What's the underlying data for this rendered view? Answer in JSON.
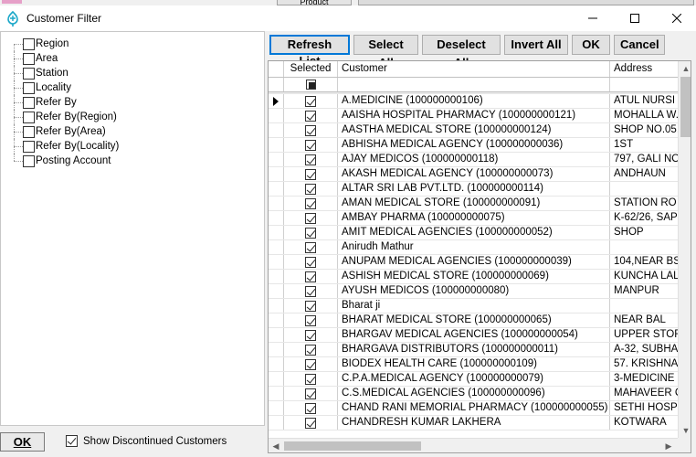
{
  "background_tab": {
    "label": "Product"
  },
  "window": {
    "title": "Customer Filter",
    "min_glyph": "—",
    "max_glyph": "☐",
    "close_glyph": "✕"
  },
  "tree": {
    "items": [
      {
        "label": "Region",
        "checked": false
      },
      {
        "label": "Area",
        "checked": false
      },
      {
        "label": "Station",
        "checked": false
      },
      {
        "label": "Locality",
        "checked": false
      },
      {
        "label": "Refer By",
        "checked": false
      },
      {
        "label": "Refer By(Region)",
        "checked": false
      },
      {
        "label": "Refer By(Area)",
        "checked": false
      },
      {
        "label": "Refer By(Locality)",
        "checked": false
      },
      {
        "label": "Posting Account",
        "checked": false
      }
    ]
  },
  "footer": {
    "ok_label": "OK",
    "show_discontinued_label": "Show Discontinued Customers",
    "show_discontinued_checked": true
  },
  "toolbar": {
    "refresh_label": "Refresh List",
    "select_all_label": "Select All",
    "deselect_all_label": "Deselect All",
    "invert_all_label": "Invert All",
    "ok_label": "OK",
    "cancel_label": "Cancel"
  },
  "grid": {
    "columns": {
      "selected": "Selected",
      "customer": "Customer",
      "address": "Address"
    },
    "rows": [
      {
        "customer": "A.MEDICINE (100000000106)",
        "address": "ATUL NURSI",
        "selected": true,
        "current": true
      },
      {
        "customer": "AAISHA HOSPITAL PHARMACY (100000000121)",
        "address": "MOHALLA W.",
        "selected": true
      },
      {
        "customer": "AASTHA MEDICAL STORE (100000000124)",
        "address": "SHOP NO.05,",
        "selected": true
      },
      {
        "customer": "ABHISHA MEDICAL AGENCY (100000000036)",
        "address": "1ST",
        "selected": true
      },
      {
        "customer": "AJAY MEDICOS (100000000118)",
        "address": "797, GALI NO",
        "selected": true
      },
      {
        "customer": "AKASH MEDICAL AGENCY (100000000073)",
        "address": "ANDHAUN",
        "selected": true
      },
      {
        "customer": "ALTAR SRI LAB PVT.LTD. (100000000114)",
        "address": "",
        "selected": true
      },
      {
        "customer": "AMAN MEDICAL STORE (100000000091)",
        "address": "STATION RO",
        "selected": true
      },
      {
        "customer": "AMBAY PHARMA (100000000075)",
        "address": "K-62/26, SAP",
        "selected": true
      },
      {
        "customer": "AMIT MEDICAL AGENCIES (100000000052)",
        "address": "SHOP",
        "selected": true
      },
      {
        "customer": "Anirudh Mathur",
        "address": "",
        "selected": true
      },
      {
        "customer": "ANUPAM MEDICAL AGENCIES (100000000039)",
        "address": "104,NEAR BS",
        "selected": true
      },
      {
        "customer": "ASHISH MEDICAL STORE (100000000069)",
        "address": "KUNCHA LAL",
        "selected": true
      },
      {
        "customer": "AYUSH MEDICOS (100000000080)",
        "address": "MANPUR",
        "selected": true
      },
      {
        "customer": "Bharat ji",
        "address": "",
        "selected": true
      },
      {
        "customer": "BHARAT MEDICAL STORE (100000000065)",
        "address": "NEAR BAL",
        "selected": true
      },
      {
        "customer": "BHARGAV MEDICAL AGENCIES (100000000054)",
        "address": "UPPER STOR",
        "selected": true
      },
      {
        "customer": "BHARGAVA DISTRIBUTORS (100000000011)",
        "address": "A-32, SUBHA",
        "selected": true
      },
      {
        "customer": "BIODEX HEALTH CARE (100000000109)",
        "address": "57. KRISHNA",
        "selected": true
      },
      {
        "customer": "C.P.A.MEDICAL AGENCY (100000000079)",
        "address": "3-MEDICINE",
        "selected": true
      },
      {
        "customer": "C.S.MEDICAL AGENCIES (100000000096)",
        "address": "MAHAVEER C",
        "selected": true
      },
      {
        "customer": "CHAND RANI MEMORIAL PHARMACY (100000000055)",
        "address": "SETHI HOSP",
        "selected": true
      },
      {
        "customer": "CHANDRESH KUMAR LAKHERA",
        "address": "KOTWARA",
        "selected": true
      }
    ]
  },
  "colors": {
    "focus": "#0078d7",
    "app_icon": "#1aa7c8"
  },
  "icons": {
    "app": "app-logo-icon",
    "scroll_up": "▲",
    "scroll_down": "▼",
    "scroll_left": "◀",
    "scroll_right": "▶"
  }
}
